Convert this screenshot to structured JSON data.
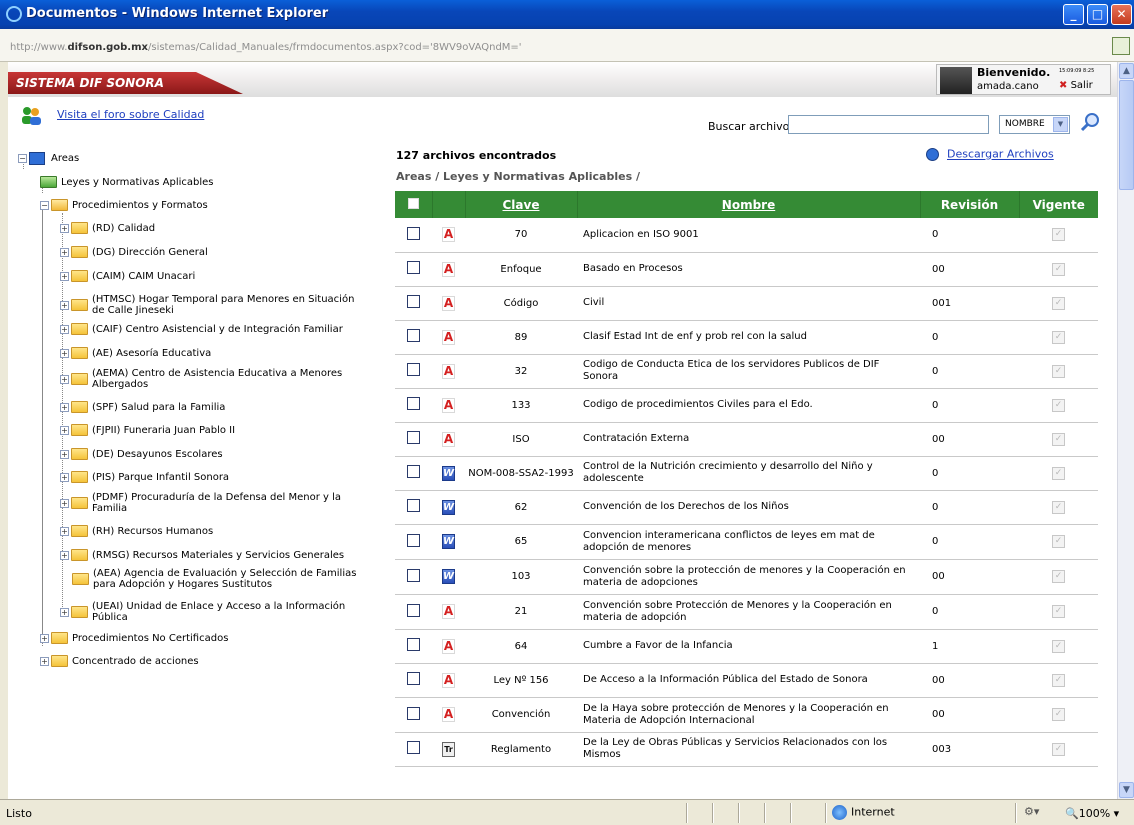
{
  "window": {
    "title": "Documentos - Windows Internet Explorer",
    "url_domain": "difson.gob.mx",
    "url_prefix": "http://www.",
    "url_path": "/sistemas/Calidad_Manuales/frmdocumentos.aspx?cod='8WV9oVAQndM='"
  },
  "header": {
    "brand": "SISTEMA DIF SONORA",
    "welcome": "Bienvenido.",
    "username": "amada.cano",
    "timestamp": "15:09:09 8:25",
    "logout": "Salir"
  },
  "forum_link": "Visita el foro sobre Calidad",
  "search": {
    "label": "Buscar archivos:",
    "value": "",
    "filter": "NOMBRE"
  },
  "results": {
    "count_text": "127 archivos encontrados",
    "breadcrumb": "Areas / Leyes y Normativas Aplicables /",
    "download": "Descargar Archivos"
  },
  "tree": {
    "root": "Areas",
    "leyes": "Leyes y Normativas Aplicables",
    "procedimientos": "Procedimientos y Formatos",
    "children": [
      {
        "l1": "(RD) Calidad",
        "l2": ""
      },
      {
        "l1": "(DG) Dirección General",
        "l2": ""
      },
      {
        "l1": "(CAIM) CAIM Unacari",
        "l2": ""
      },
      {
        "l1": "(HTMSC) Hogar Temporal para Menores en Situación",
        "l2": "de Calle Jineseki"
      },
      {
        "l1": "(CAIF) Centro Asistencial y de Integración Familiar",
        "l2": ""
      },
      {
        "l1": "(AE) Asesoría Educativa",
        "l2": ""
      },
      {
        "l1": "(AEMA) Centro de Asistencia Educativa a Menores",
        "l2": "Albergados"
      },
      {
        "l1": "(SPF) Salud para la Familia",
        "l2": ""
      },
      {
        "l1": "(FJPII) Funeraria Juan Pablo II",
        "l2": ""
      },
      {
        "l1": "(DE) Desayunos Escolares",
        "l2": ""
      },
      {
        "l1": "(PIS) Parque Infantil Sonora",
        "l2": ""
      },
      {
        "l1": "(PDMF) Procuraduría de la Defensa del Menor y la",
        "l2": "Familia"
      },
      {
        "l1": "(RH) Recursos Humanos",
        "l2": ""
      },
      {
        "l1": "(RMSG) Recursos Materiales y Servicios Generales",
        "l2": ""
      },
      {
        "l1": "(AEA) Agencia de Evaluación y Selección de Familias",
        "l2": "para Adopción y Hogares Sustitutos"
      },
      {
        "l1": "(UEAI) Unidad de Enlace y Acceso a la Información",
        "l2": "Pública"
      }
    ],
    "no_cert": "Procedimientos No Certificados",
    "concentrado": "Concentrado de acciones"
  },
  "table": {
    "headers": {
      "clave": "Clave",
      "nombre": "Nombre",
      "revision": "Revisión",
      "vigente": "Vigente"
    },
    "rows": [
      {
        "type": "pdf",
        "clave": "70",
        "nombre": "Aplicacion en ISO 9001",
        "rev": "0"
      },
      {
        "type": "pdf",
        "clave": "Enfoque",
        "nombre": "Basado en Procesos",
        "rev": "00"
      },
      {
        "type": "pdf",
        "clave": "Código",
        "nombre": "Civil",
        "rev": "001"
      },
      {
        "type": "pdf",
        "clave": "89",
        "nombre": "Clasif Estad Int de enf y prob rel con la salud",
        "rev": "0"
      },
      {
        "type": "pdf",
        "clave": "32",
        "nombre": "Codigo de Conducta Etica de los servidores Publicos de DIF Sonora",
        "rev": "0"
      },
      {
        "type": "pdf",
        "clave": "133",
        "nombre": "Codigo de procedimientos Civiles para el Edo.",
        "rev": "0"
      },
      {
        "type": "pdf",
        "clave": "ISO",
        "nombre": "Contratación Externa",
        "rev": "00"
      },
      {
        "type": "doc",
        "clave": "NOM-008-SSA2-1993",
        "nombre": "Control de la Nutrición crecimiento y desarrollo del Niño y adolescente",
        "rev": "0"
      },
      {
        "type": "doc",
        "clave": "62",
        "nombre": "Convención de los Derechos de los Niños",
        "rev": "0"
      },
      {
        "type": "doc",
        "clave": "65",
        "nombre": "Convencion interamericana conflictos de leyes em mat de adopción de menores",
        "rev": "0"
      },
      {
        "type": "doc",
        "clave": "103",
        "nombre": "Convención sobre la protección de menores y la Cooperación en materia de adopciones",
        "rev": "00"
      },
      {
        "type": "pdf",
        "clave": "21",
        "nombre": "Convención sobre Protección de Menores y la Cooperación en materia de adopción",
        "rev": "0"
      },
      {
        "type": "pdf",
        "clave": "64",
        "nombre": "Cumbre a Favor de la Infancia",
        "rev": "1"
      },
      {
        "type": "pdf",
        "clave": "Ley Nº 156",
        "nombre": "De Acceso a la Información Pública del Estado de Sonora",
        "rev": "00"
      },
      {
        "type": "pdf",
        "clave": "Convención",
        "nombre": "De la Haya sobre protección de Menores y la Cooperación en Materia de Adopción Internacional",
        "rev": "00"
      },
      {
        "type": "tif",
        "clave": "Reglamento",
        "nombre": "De la Ley de Obras Públicas y Servicios Relacionados con los Mismos",
        "rev": "003"
      }
    ]
  },
  "status": {
    "text": "Listo",
    "zone": "Internet",
    "zoom": "100%"
  },
  "colors": {
    "header_green": "#358b35",
    "brand_red": "#b02828",
    "link_blue": "#1f3fbf"
  }
}
